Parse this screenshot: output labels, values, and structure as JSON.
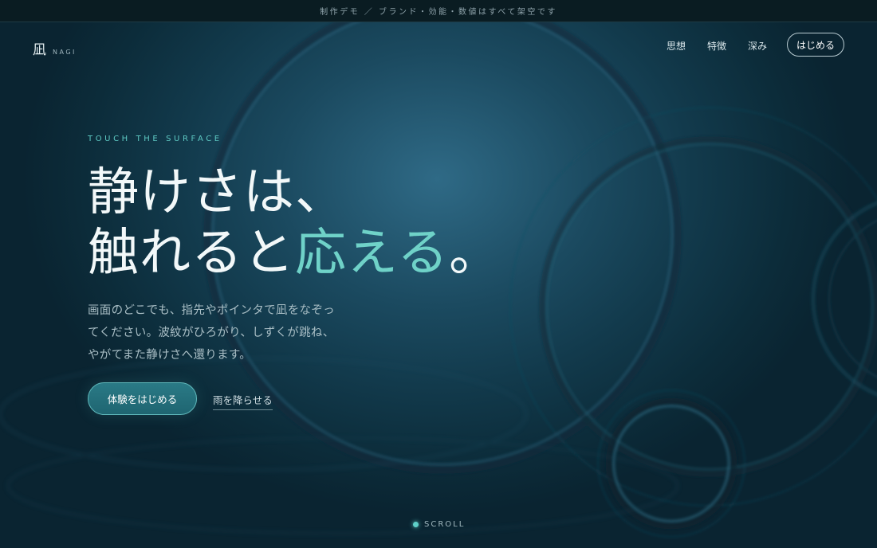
{
  "notice": {
    "text": "制作デモ ／ ブランド・効能・数値はすべて架空です"
  },
  "brand": {
    "mark": "凪",
    "word": "NAGI"
  },
  "nav": {
    "items": [
      {
        "label": "思想"
      },
      {
        "label": "特徴"
      },
      {
        "label": "深み"
      }
    ],
    "cta_label": "はじめる"
  },
  "hero": {
    "eyebrow": "TOUCH THE SURFACE",
    "headline_line1": "静けさは、",
    "headline_line2_plain": "触れると",
    "headline_line2_accent": "応える",
    "headline_line2_end": "。",
    "lead_lines": [
      "画面のどこでも、指先やポインタで凪をなぞっ",
      "てください。波紋がひろがり、しずくが跳ね、",
      "やがてまた静けさへ還ります。"
    ],
    "primary_label": "体験をはじめる",
    "secondary_label": "雨を降らせる"
  },
  "scroll": {
    "label": "SCROLL"
  },
  "colors": {
    "accent": "#6fd2c8",
    "background": "#123a4c",
    "notice_bar": "#0a1c22"
  }
}
